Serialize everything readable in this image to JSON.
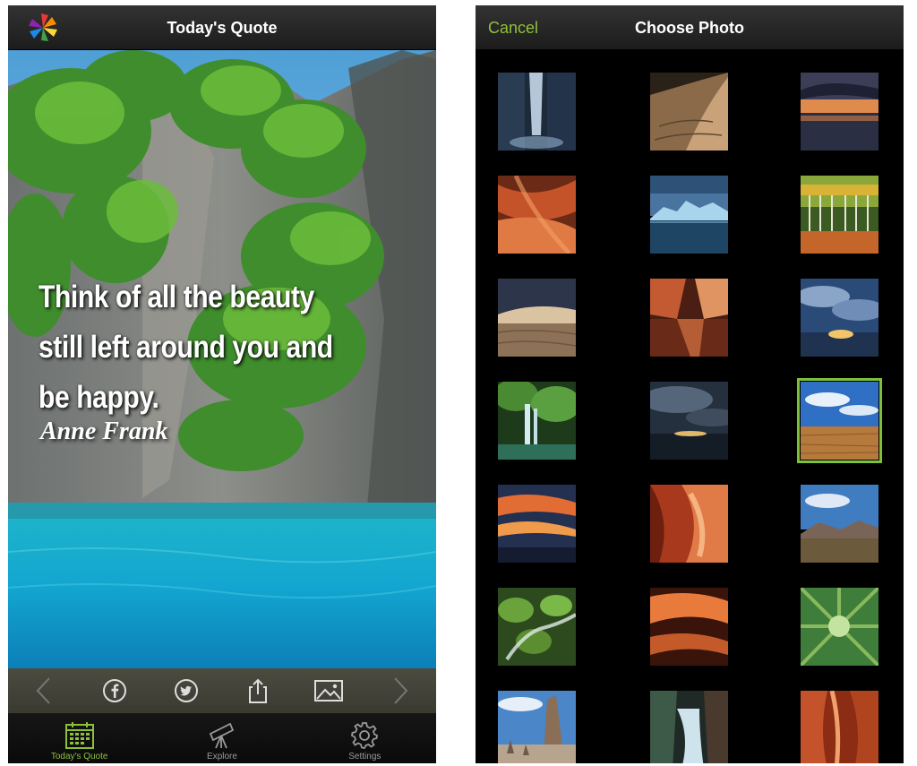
{
  "left_screen": {
    "title": "Today's Quote",
    "quote": "Think of all the beauty still left around you and be happy.",
    "author": "Anne Frank",
    "actions": [
      "previous-icon",
      "facebook-icon",
      "twitter-icon",
      "share-icon",
      "photo-icon",
      "next-icon"
    ],
    "tabs": [
      {
        "label": "Today's Quote",
        "icon": "calendar-icon",
        "active": true
      },
      {
        "label": "Explore",
        "icon": "telescope-icon",
        "active": false
      },
      {
        "label": "Settings",
        "icon": "gear-icon",
        "active": false
      }
    ]
  },
  "right_screen": {
    "title": "Choose Photo",
    "cancel_label": "Cancel",
    "photos": [
      "waterfall",
      "sand-dune",
      "sunset-lake",
      "red-canyon",
      "iceberg",
      "autumn-forest",
      "desert-dunes",
      "canyon-reflection",
      "cloud-sunset",
      "jungle-waterfall",
      "cloudy-sunset-sea",
      "desert-blue-sky",
      "orange-sky",
      "slot-canyon",
      "desert-mountain",
      "mossy-stream",
      "canyon-arch",
      "tall-trees",
      "rock-spire",
      "river-gorge",
      "canyon-walls"
    ],
    "selected_photo": "desert-blue-sky"
  },
  "colors": {
    "accent": "#8fc03a",
    "selected_border": "#7fbf3a"
  }
}
